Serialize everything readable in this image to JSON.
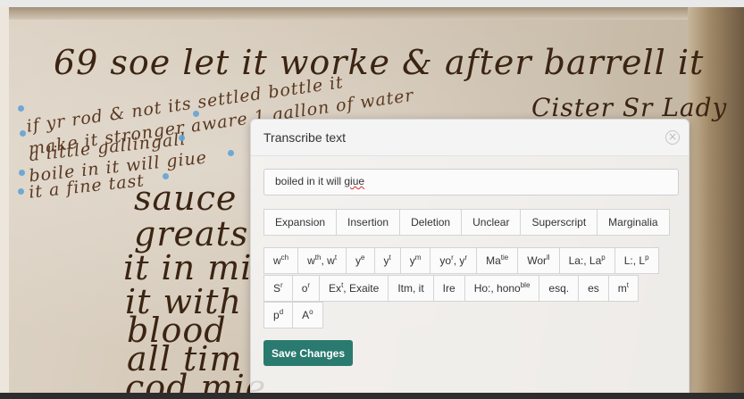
{
  "manuscript": {
    "lines": [
      "69 soe let it worke & after barrell it",
      "if yr rod & not its settled bottle it",
      "make it stronger aware 1 gallon of water",
      "a little gallingall",
      "boile in it will giue",
      "it a fine tast",
      "sauce",
      "greats",
      "it in mi",
      "it with",
      "blood",
      "all tim",
      "cod mie",
      "Cister Sr Lady"
    ]
  },
  "modal": {
    "title": "Transcribe text",
    "close_icon": "close-circle-icon",
    "input_prefix": "boiled in it will ",
    "input_word": "giue",
    "tag_buttons": [
      "Expansion",
      "Insertion",
      "Deletion",
      "Unclear",
      "Superscript",
      "Marginalia"
    ],
    "char_row1": [
      {
        "base": "w",
        "sup": "ch"
      },
      {
        "base": "w",
        "sup": "th",
        "mid": ", w",
        "sup2": "t"
      },
      {
        "base": "y",
        "sup": "e"
      },
      {
        "base": "y",
        "sup": "t"
      },
      {
        "base": "y",
        "sup": "m"
      },
      {
        "base": "yo",
        "sup": "r",
        "mid": ", y",
        "sup2": "r"
      },
      {
        "base": "Ma",
        "sup": "tie"
      },
      {
        "base": "Wor",
        "sup": "ll"
      },
      {
        "base": "La:, La",
        "sup": "p"
      },
      {
        "base": "L:, L",
        "sup": "p"
      }
    ],
    "char_row2": [
      {
        "base": "S",
        "sup": "r"
      },
      {
        "base": "o",
        "sup": "r"
      },
      {
        "base": "Ex",
        "sup": "t",
        "mid": ", Exaite"
      },
      {
        "base": "Itm, it"
      },
      {
        "base": "Ire"
      },
      {
        "base": "Ho:, hono",
        "sup": "ble"
      },
      {
        "base": "esq."
      },
      {
        "base": "es"
      },
      {
        "base": "m",
        "sup": "t"
      }
    ],
    "char_row3": [
      {
        "base": "p",
        "sup": "d"
      },
      {
        "base": "A",
        "sup": "o"
      }
    ],
    "save_label": "Save Changes",
    "accent_color": "#2a7a6f"
  }
}
